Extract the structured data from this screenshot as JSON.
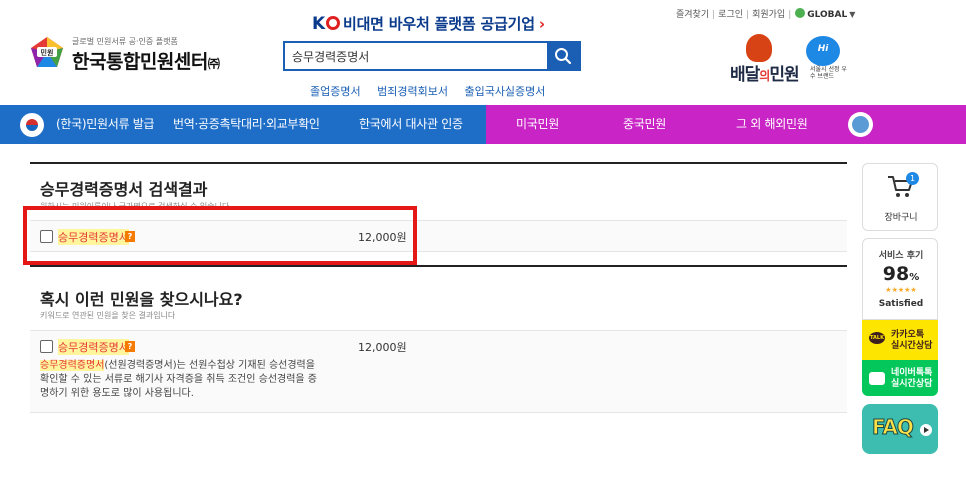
{
  "header": {
    "logo_sub": "글로벌 민원서류 공·인증 플랫폼",
    "logo_main": "한국통합민원센터",
    "logo_corp": "㈜",
    "logo_badge": "민원",
    "promo_k": "K",
    "promo_text": "비대면 바우처 플랫폼 공급기업",
    "promo_arrow": "›",
    "search_value": "승무경력증명서",
    "quick_links": [
      "졸업증명서",
      "범죄경력회보서",
      "출입국사실증명서"
    ],
    "util_links": [
      "즐겨찾기",
      "로그인",
      "회원가입"
    ],
    "util_global": "GLOBAL",
    "brand_name_1": "배달",
    "brand_name_dot": "의",
    "brand_name_2": "민원",
    "brand_badge": "Hi Seoul",
    "brand_badge_sub": "서울시 선정 우수 브랜드"
  },
  "nav": {
    "items": [
      "(한국)민원서류 발급",
      "번역·공증촉탁대리·외교부확인",
      "한국에서 대사관 인증",
      "미국민원",
      "중국민원",
      "그 외 해외민원"
    ],
    "blue": "#1e6ec8",
    "pink": "#c924c5"
  },
  "section1": {
    "title": "승무경력증명서 검색결과",
    "desc": "원하시는 민원이름이나 국가명으로 검색하실 수 있습니다",
    "item_name": "승무경력증명서",
    "item_price": "12,000원"
  },
  "section2": {
    "title": "혹시 이런 민원을 찾으시나요?",
    "desc": "키워드로 연관된 민원을 찾은 결과입니다",
    "item_name": "승무경력증명서",
    "item_price": "12,000원",
    "desc_highlight": "승무경력증명서",
    "desc_rest": "(선원경력증명서)는 선원수첩상 기재된 승선경력을 확인할 수 있는 서류로 해기사 자격증을 취득 조건인 승선경력을 증명하기 위한 용도로 많이 사용됩니다."
  },
  "question_mark": "?",
  "sidebar": {
    "cart_count": "1",
    "cart_label": "장바구니",
    "review_title": "서비스 후기",
    "review_score": "98",
    "review_unit": "%",
    "review_stars": "★★★★★",
    "review_status": "Satisfied",
    "kakao_icon": "TALK",
    "kakao_line1": "카카오톡",
    "kakao_line2": "실시간상담",
    "naver_line1": "네이버톡톡",
    "naver_line2": "실시간상담",
    "faq": "FAQ"
  },
  "colors": {
    "highlight_box": "#e51818",
    "item_name": "#e53935",
    "link": "#1a5fb4"
  }
}
